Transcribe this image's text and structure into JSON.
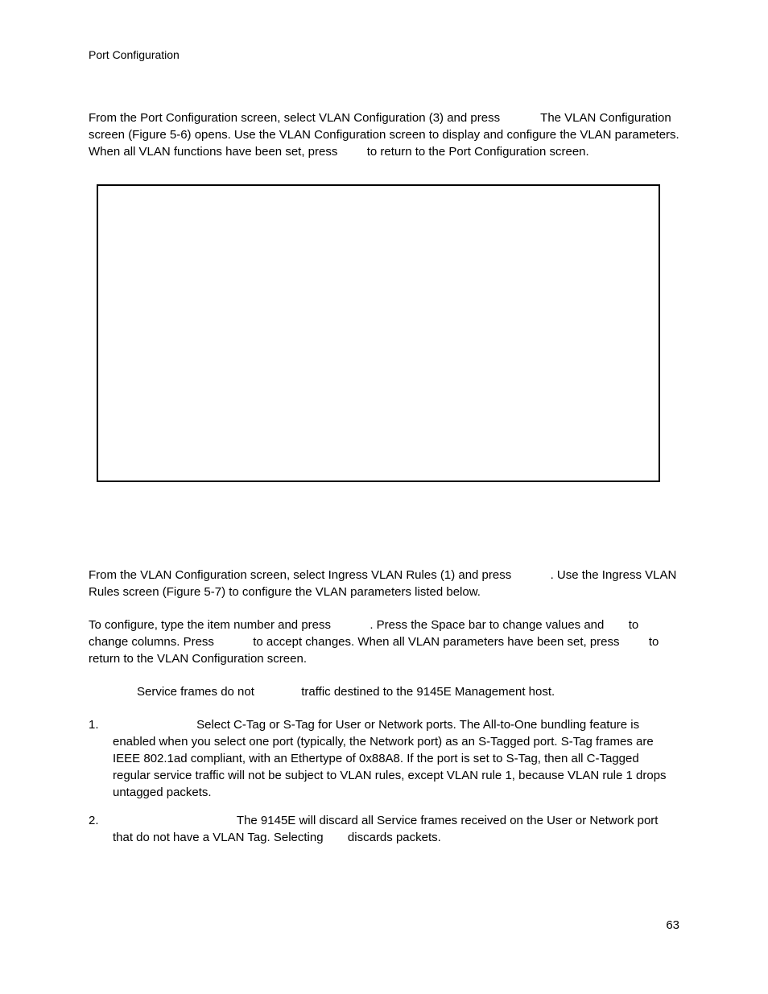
{
  "header": "Port Configuration",
  "para1_a": "From the Port Configuration screen, select VLAN Configuration (3) and press ",
  "para1_b": " The VLAN Configuration screen (Figure 5-6) opens. Use the VLAN Configuration screen to display and configure the VLAN parameters. When all VLAN functions have been set, press ",
  "para1_c": " to return to the Port Configuration screen.",
  "para2_a": "From the VLAN Configuration screen, select Ingress VLAN Rules (1) and press ",
  "para2_b": ". Use the Ingress VLAN Rules screen (Figure 5-7) to configure the VLAN parameters listed below.",
  "para3_a": "To configure, type the item number and press ",
  "para3_b": ". Press the Space bar to change values and ",
  "para3_c": " to change columns. Press ",
  "para3_d": " to accept changes. When all VLAN parameters have been set, press ",
  "para3_e": " to return to the VLAN Configuration screen.",
  "note_a": "Service frames do not ",
  "note_b": " traffic destined to the 9145E Management host.",
  "item1_num": "1.",
  "item1_text": " Select C-Tag or S-Tag for User or Network ports. The All-to-One bundling feature is enabled when you select one port (typically, the Network port) as an S-Tagged port. S-Tag frames are IEEE 802.1ad compliant, with an Ethertype of 0x88A8. If the port is set to S-Tag, then all C-Tagged regular service traffic will not be subject to VLAN rules, except VLAN rule 1, because VLAN rule 1 drops untagged packets.",
  "item2_num": "2.",
  "item2_a": " The 9145E will discard all Service frames received on the User or Network port that do not have a VLAN Tag. Selecting ",
  "item2_b": " discards packets.",
  "page_number": "63"
}
